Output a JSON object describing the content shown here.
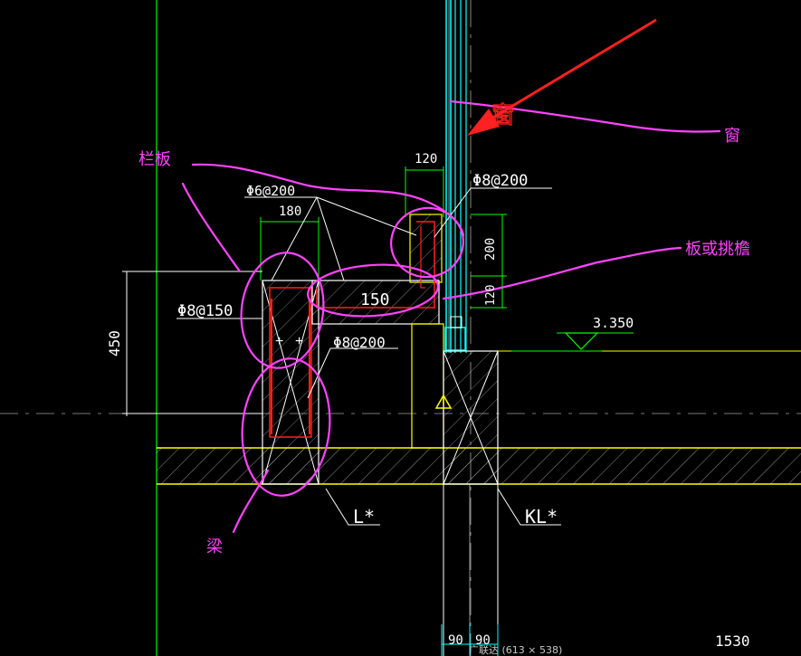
{
  "colors": {
    "background": "#000000",
    "annotation": "#ff44ff",
    "arrow": "#ff2020",
    "dimension": "#ffffff",
    "dim_ext": "#00ff00",
    "concrete": "#ffff00",
    "rebar": "#ff2020",
    "glass": "#00ffff",
    "axis": "#00cc00"
  },
  "annotations": {
    "window": "窗",
    "window_arrow_text": "窗",
    "parapet": "栏板",
    "slab_or_eave": "板或挑檐",
    "beam": "梁"
  },
  "dimensions": {
    "top_width": "120",
    "slab_rebar": "Φ8@200",
    "parapet_rebar": "Φ6@200",
    "parapet_width": "180",
    "upturn_height": "200",
    "slab_thickness": "120",
    "beam_height": "450",
    "beam_stirrup": "Φ8@150",
    "slab_length": "150",
    "beam_rebar": "Φ8@200",
    "elevation": "3.350",
    "bottom_left": "90",
    "bottom_right": "90",
    "bottom_far": "1530"
  },
  "labels": {
    "beam_l": "L*",
    "beam_kl": "KL*"
  },
  "status": {
    "watermark": "广联达 (613 × 538)"
  },
  "icons": [
    "warning-triangle-icon",
    "elevation-marker-icon",
    "red-arrow-icon"
  ]
}
